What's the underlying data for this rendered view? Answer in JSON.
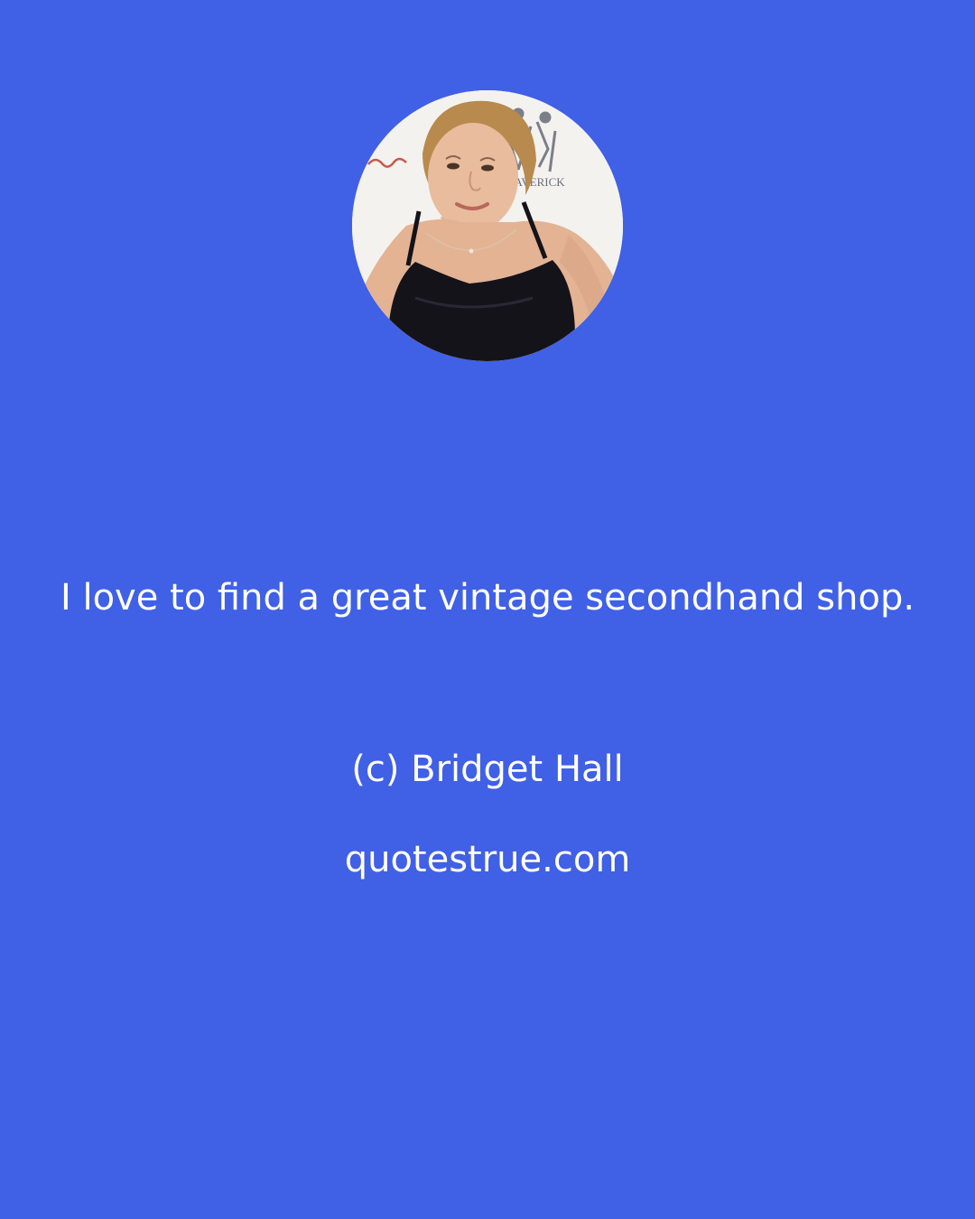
{
  "background_color": "#4060e6",
  "text_color": "#ffffff",
  "portrait": {
    "icon": "person-photo",
    "backdrop_logo_text": "MAVERICK"
  },
  "quote": {
    "text": "I love to find a great vintage secondhand shop."
  },
  "author": {
    "text": "(c) Bridget Hall"
  },
  "site": {
    "text": "quotestrue.com"
  }
}
